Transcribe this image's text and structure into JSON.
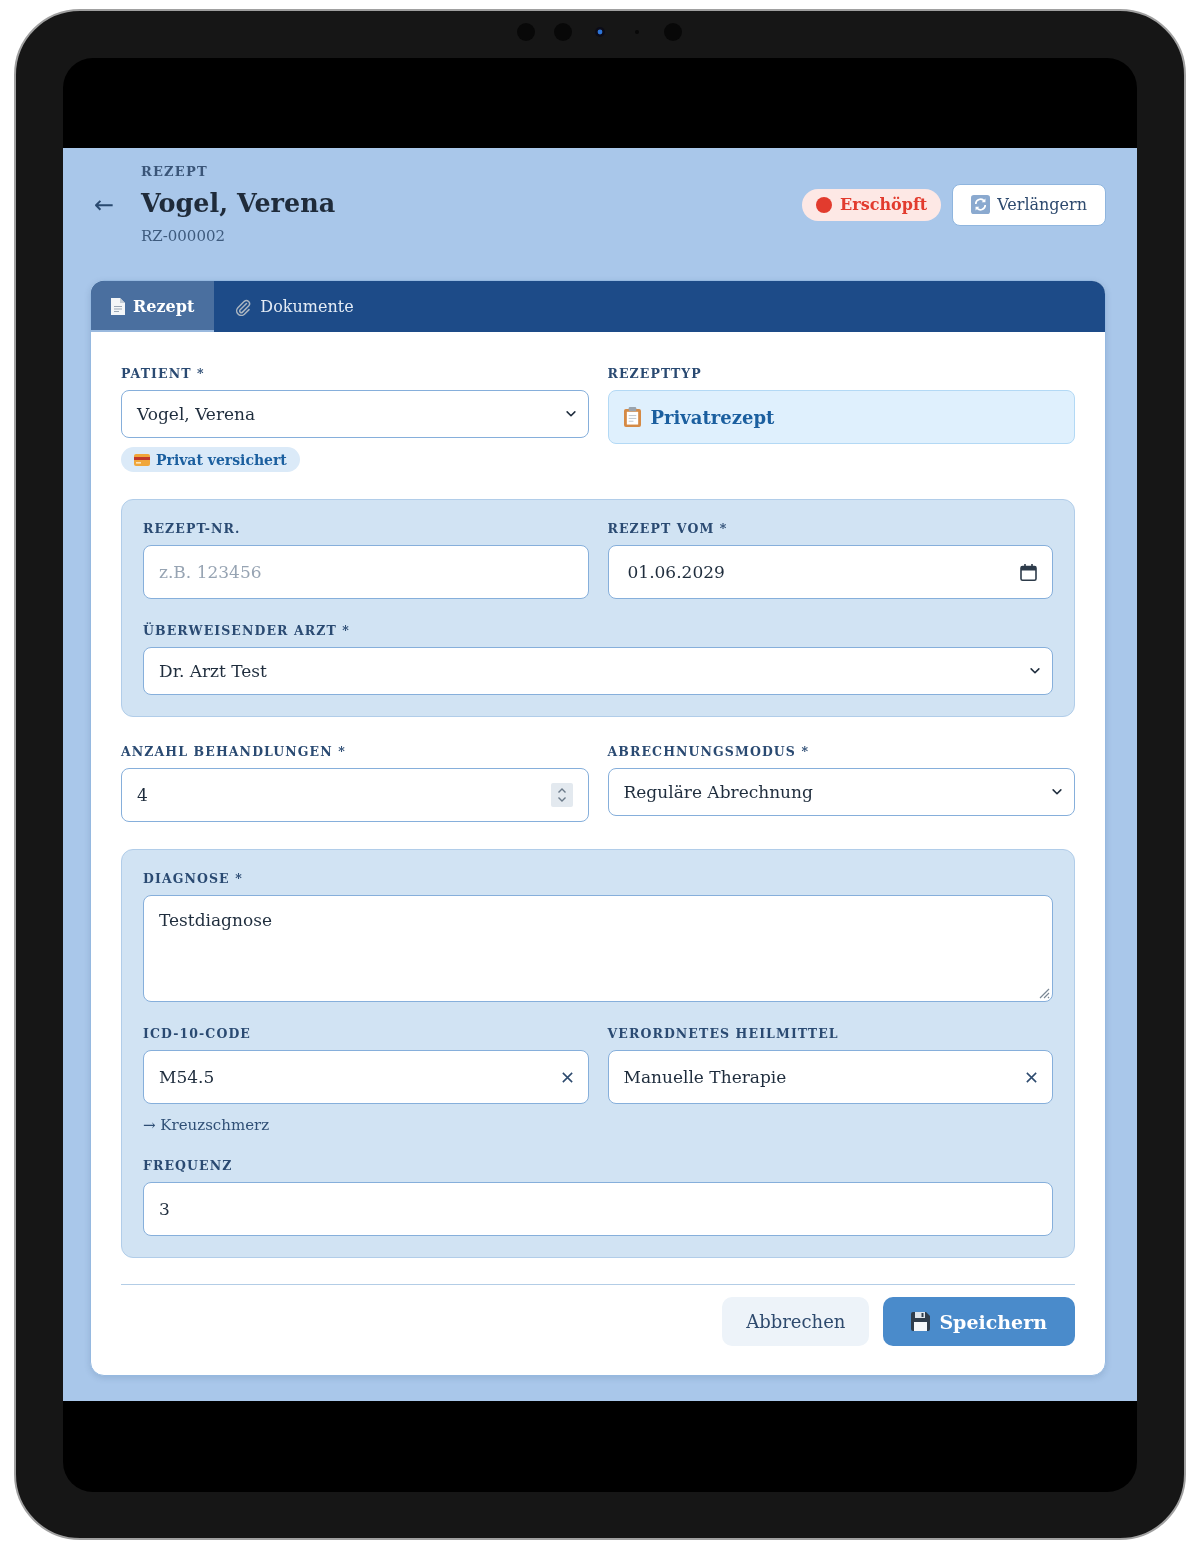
{
  "header": {
    "back": "←",
    "eyebrow": "REZEPT",
    "title": "Vogel, Verena",
    "subtitle": "RZ-000002",
    "status": {
      "label": "Erschöpft",
      "color": "#e23b2e"
    },
    "action": "Verlängern"
  },
  "tabs": [
    {
      "label": "Rezept",
      "selected": true
    },
    {
      "label": "Dokumente",
      "selected": false
    }
  ],
  "sections": [
    {
      "kind": "plain",
      "rows": [
        [
          {
            "kind": "select",
            "label": "PATIENT *",
            "value": "Vogel, Verena",
            "tag": "Privat versichert"
          },
          {
            "kind": "display",
            "label": "REZEPTTYP",
            "value": "Privatrezept"
          }
        ]
      ]
    },
    {
      "kind": "panel",
      "rows": [
        [
          {
            "kind": "text",
            "label": "REZEPT-NR.",
            "placeholder": "z.B. 123456"
          },
          {
            "kind": "date",
            "label": "REZEPT VOM *",
            "value": "01.06.2029"
          }
        ],
        [
          {
            "kind": "select",
            "label": "ÜBERWEISENDER ARZT *",
            "value": "Dr. Arzt Test"
          }
        ]
      ]
    },
    {
      "kind": "plain",
      "rows": [
        [
          {
            "kind": "number",
            "label": "ANZAHL BEHANDLUNGEN *",
            "value": "4"
          },
          {
            "kind": "select",
            "label": "ABRECHNUNGSMODUS *",
            "value": "Reguläre Abrechnung"
          }
        ]
      ]
    },
    {
      "kind": "panel",
      "rows": [
        [
          {
            "kind": "textarea",
            "label": "DIAGNOSE *",
            "value": "Testdiagnose"
          }
        ],
        [
          {
            "kind": "clearable",
            "label": "ICD-10-CODE",
            "value": "M54.5",
            "hint": "→ Kreuzschmerz"
          },
          {
            "kind": "clearable",
            "label": "VERORDNETES HEILMITTEL",
            "value": "Manuelle Therapie"
          }
        ],
        [
          {
            "kind": "text",
            "label": "FREQUENZ",
            "value": "3"
          }
        ]
      ]
    }
  ],
  "footer": {
    "buttons": [
      {
        "label": "Abbrechen",
        "kind": "secondary"
      },
      {
        "label": "Speichern",
        "kind": "primary"
      }
    ]
  }
}
